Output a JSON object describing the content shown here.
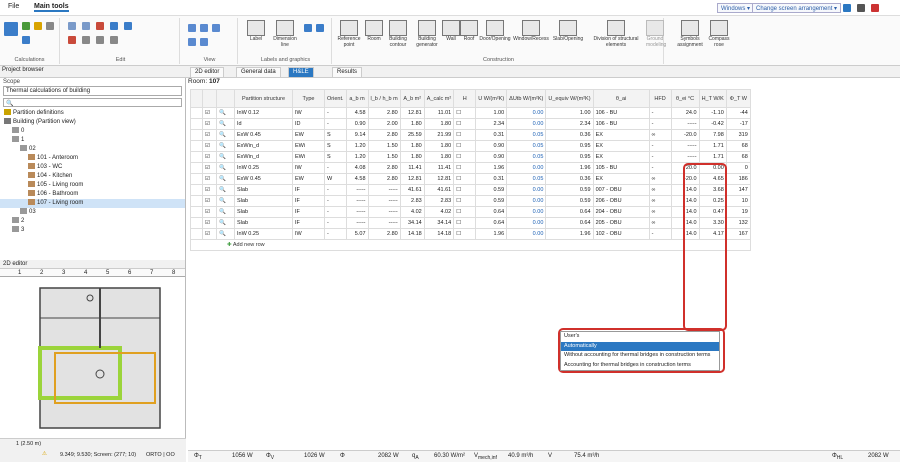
{
  "menu": {
    "file": "File",
    "main_tools": "Main tools"
  },
  "top_right": {
    "windows": "Windows ▾",
    "screen_arrangement": "Change screen arrangement ▾"
  },
  "ribbon": {
    "groups": [
      "Calculations",
      "Edit",
      "View",
      "Labels and graphics",
      "Construction"
    ],
    "buttons": {
      "label": "Label",
      "dimension_line": "Dimension line",
      "reference_point": "Reference point",
      "room": "Room",
      "building_contour": "Building contour",
      "building_generator": "Building generator",
      "wall": "Wall",
      "roof": "Roof",
      "door_opening": "Door/Opening",
      "window_recess": "Window/Recess",
      "slab_opening": "Slab/Opening",
      "division_structural": "Division of structural elements",
      "ground_modeling": "Ground modeling",
      "symbols_assignment": "Symbols assignment",
      "compass_rose": "Compass rose"
    }
  },
  "project_browser": {
    "title": "Project browser",
    "scope_label": "Scope",
    "scope_value": "Thermal calculations of building",
    "tree": [
      {
        "label": "Partition definitions",
        "indent": 0
      },
      {
        "label": "Building (Partition view)",
        "indent": 0
      },
      {
        "label": "0",
        "indent": 1
      },
      {
        "label": "1",
        "indent": 1
      },
      {
        "label": "02",
        "indent": 2
      },
      {
        "label": "101 - Anteroom",
        "indent": 3
      },
      {
        "label": "103 - WC",
        "indent": 3
      },
      {
        "label": "104 - Kitchen",
        "indent": 3
      },
      {
        "label": "105 - Living room",
        "indent": 3
      },
      {
        "label": "106 - Bathroom",
        "indent": 3
      },
      {
        "label": "107 - Living room",
        "indent": 3,
        "selected": true
      },
      {
        "label": "03",
        "indent": 2
      },
      {
        "label": "2",
        "indent": 1
      },
      {
        "label": "3",
        "indent": 1
      }
    ]
  },
  "editor": {
    "title": "2D editor",
    "ruler": [
      "1",
      "2",
      "3",
      "4",
      "5",
      "6",
      "7",
      "8"
    ],
    "level": "1 (2.50 m)",
    "coords": "9.349; 9.530; Screen: (277; 10)",
    "orto": "ORTO | OO"
  },
  "tabs": [
    "2D editor",
    "General data",
    "H&LE",
    "Results"
  ],
  "room": {
    "label": "Room:",
    "number": "107"
  },
  "table": {
    "headers": [
      "Partition structure",
      "Type",
      "Orient.",
      "a_b m",
      "l_b / h_b m",
      "A_b m²",
      "A_calc m²",
      "H",
      "U W/(m²K)",
      "ΔUtb W/(m²K)",
      "U_equiv W/(m²K)",
      "θ_ai",
      "HFD",
      "θ_ei °C",
      "H_T W/K",
      "Φ_T W"
    ],
    "rows": [
      {
        "name": "InW 0.12",
        "type": "IW",
        "orient": "-",
        "a": "4.58",
        "l": "2.80",
        "Ab": "12.81",
        "Acalc": "11.01",
        "U": "1.00",
        "dU": "0.00",
        "Ueq": "1.00",
        "adj": "106 - BU",
        "hfd": "-",
        "te": "24.0",
        "ht": "-1.10",
        "phi": "-44"
      },
      {
        "name": "Id",
        "type": "ID",
        "orient": "-",
        "a": "0.90",
        "l": "2.00",
        "Ab": "1.80",
        "Acalc": "1.80",
        "U": "2.34",
        "dU": "0.00",
        "Ueq": "2.34",
        "adj": "106 - BU",
        "hfd": "-",
        "te": "-----",
        "ht": "-0.42",
        "phi": "-17"
      },
      {
        "name": "ExW 0.45",
        "type": "EW",
        "orient": "S",
        "a": "9.14",
        "l": "2.80",
        "Ab": "25.59",
        "Acalc": "21.99",
        "U": "0.31",
        "dU": "0.05",
        "Ueq": "0.36",
        "adj": "EX",
        "hfd": "∞",
        "te": "-20.0",
        "ht": "7.98",
        "phi": "319"
      },
      {
        "name": "ExWin_d",
        "type": "EWi",
        "orient": "S",
        "a": "1.20",
        "l": "1.50",
        "Ab": "1.80",
        "Acalc": "1.80",
        "U": "0.90",
        "dU": "0.05",
        "Ueq": "0.95",
        "adj": "EX",
        "hfd": "-",
        "te": "-----",
        "ht": "1.71",
        "phi": "68"
      },
      {
        "name": "ExWin_d",
        "type": "EWi",
        "orient": "S",
        "a": "1.20",
        "l": "1.50",
        "Ab": "1.80",
        "Acalc": "1.80",
        "U": "0.90",
        "dU": "0.05",
        "Ueq": "0.95",
        "adj": "EX",
        "hfd": "-",
        "te": "-----",
        "ht": "1.71",
        "phi": "68"
      },
      {
        "name": "InW 0.25",
        "type": "IW",
        "orient": "-",
        "a": "4.08",
        "l": "2.80",
        "Ab": "11.41",
        "Acalc": "11.41",
        "U": "1.96",
        "dU": "0.00",
        "Ueq": "1.96",
        "adj": "105 - BU",
        "hfd": "-",
        "te": "20.0",
        "ht": "0.00",
        "phi": "0"
      },
      {
        "name": "ExW 0.45",
        "type": "EW",
        "orient": "W",
        "a": "4.58",
        "l": "2.80",
        "Ab": "12.81",
        "Acalc": "12.81",
        "U": "0.31",
        "dU": "0.05",
        "Ueq": "0.36",
        "adj": "EX",
        "hfd": "∞",
        "te": "-20.0",
        "ht": "4.65",
        "phi": "186"
      },
      {
        "name": "Slab",
        "type": "IF",
        "orient": "-",
        "a": "-----",
        "l": "-----",
        "Ab": "41.61",
        "Acalc": "41.61",
        "U": "0.59",
        "dU": "0.00",
        "Ueq": "0.59",
        "adj": "007 - OBU",
        "hfd": "∞",
        "te": "14.0",
        "ht": "3.68",
        "phi": "147"
      },
      {
        "name": "Slab",
        "type": "IF",
        "orient": "-",
        "a": "-----",
        "l": "-----",
        "Ab": "2.83",
        "Acalc": "2.83",
        "U": "0.59",
        "dU": "0.00",
        "Ueq": "0.59",
        "adj": "206 - OBU",
        "hfd": "∞",
        "te": "14.0",
        "ht": "0.25",
        "phi": "10"
      },
      {
        "name": "Slab",
        "type": "IF",
        "orient": "-",
        "a": "-----",
        "l": "-----",
        "Ab": "4.02",
        "Acalc": "4.02",
        "U": "0.64",
        "dU": "0.00",
        "Ueq": "0.64",
        "adj": "204 - OBU",
        "hfd": "∞",
        "te": "14.0",
        "ht": "0.47",
        "phi": "19"
      },
      {
        "name": "Slab",
        "type": "IF",
        "orient": "-",
        "a": "-----",
        "l": "-----",
        "Ab": "34.14",
        "Acalc": "34.14",
        "U": "0.64",
        "dU": "0.00",
        "Ueq": "0.64",
        "adj": "205 - OBU",
        "hfd": "∞",
        "te": "14.0",
        "ht": "3.30",
        "phi": "132"
      },
      {
        "name": "InW 0.25",
        "type": "IW",
        "orient": "-",
        "a": "5.07",
        "l": "2.80",
        "Ab": "14.18",
        "Acalc": "14.18",
        "U": "1.96",
        "dU": "0.00",
        "Ueq": "1.96",
        "adj": "102 - OBU",
        "hfd": "-",
        "te": "14.0",
        "ht": "4.17",
        "phi": "167"
      }
    ],
    "add_row": "Add new row"
  },
  "dropdown": {
    "options": [
      "User's",
      "Automatically",
      "Without accounting for thermal bridges in construction terms",
      "Accounting for thermal bridges in construction terms"
    ],
    "selected": "Automatically"
  },
  "status": {
    "phi_t": "1056 W",
    "phi_v": "1026 W",
    "phi": "2082 W",
    "qa": "60.30 W/m²",
    "vmech": "40.9 m³/h",
    "v": "75.4 m³/h",
    "phi_hl": "2082 W"
  },
  "colors": {
    "accent": "#2b78c2",
    "highlight": "#d0302b"
  }
}
